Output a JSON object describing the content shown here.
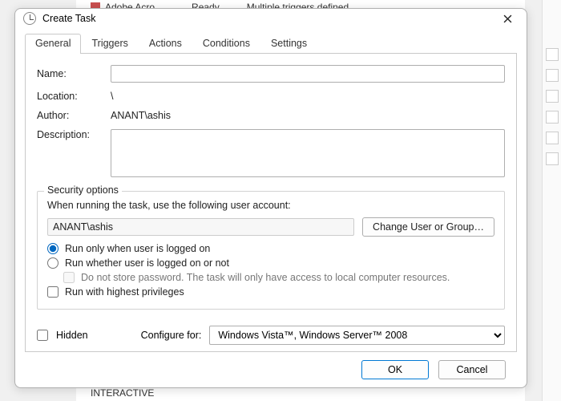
{
  "background": {
    "top_item_name": "Adobe Acro…",
    "top_status": "Ready",
    "top_triggers": "Multiple triggers defined",
    "bottom_item": "INTERACTIVE"
  },
  "dialog": {
    "title": "Create Task",
    "tabs": [
      "General",
      "Triggers",
      "Actions",
      "Conditions",
      "Settings"
    ],
    "active_tab": 0,
    "fields": {
      "name_label": "Name:",
      "name_value": "",
      "location_label": "Location:",
      "location_value": "\\",
      "author_label": "Author:",
      "author_value": "ANANT\\ashis",
      "description_label": "Description:",
      "description_value": ""
    },
    "security": {
      "legend": "Security options",
      "when_running": "When running the task, use the following user account:",
      "account": "ANANT\\ashis",
      "change_btn": "Change User or Group…",
      "radio_logged_on": "Run only when user is logged on",
      "radio_whether": "Run whether user is logged on or not",
      "dont_store": "Do not store password.  The task will only have access to local computer resources.",
      "highest": "Run with highest privileges",
      "selected_radio": "logged_on",
      "dont_store_checked": false,
      "highest_checked": false
    },
    "hidden_label": "Hidden",
    "hidden_checked": false,
    "configure_label": "Configure for:",
    "configure_value": "Windows Vista™, Windows Server™ 2008",
    "ok": "OK",
    "cancel": "Cancel"
  }
}
